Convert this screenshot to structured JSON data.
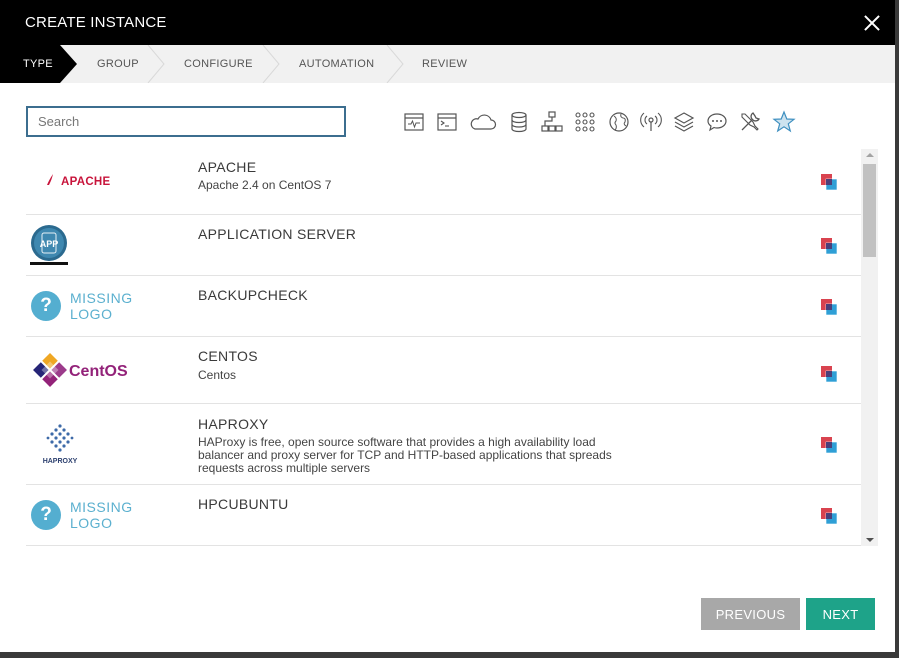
{
  "modal": {
    "title": "CREATE INSTANCE"
  },
  "wizard": {
    "steps": [
      {
        "label": "TYPE",
        "active": true
      },
      {
        "label": "GROUP",
        "active": false
      },
      {
        "label": "CONFIGURE",
        "active": false
      },
      {
        "label": "AUTOMATION",
        "active": false
      },
      {
        "label": "REVIEW",
        "active": false
      }
    ]
  },
  "search": {
    "placeholder": "Search",
    "value": ""
  },
  "filters": [
    "web-icon",
    "terminal-icon",
    "cloud-icon",
    "database-icon",
    "network-icon",
    "grid-icon",
    "globe-icon",
    "wireless-icon",
    "layers-icon",
    "chat-icon",
    "tools-icon",
    "star-icon"
  ],
  "items": [
    {
      "name": "APACHE",
      "description": "Apache 2.4 on CentOS 7",
      "logo": "apache-logo",
      "logo_text": "APACHE"
    },
    {
      "name": "APPLICATION SERVER",
      "description": "",
      "logo": "app-logo",
      "logo_text": "APP"
    },
    {
      "name": "BACKUPCHECK",
      "description": "",
      "logo": "missing-logo",
      "logo_text": "MISSING LOGO"
    },
    {
      "name": "CENTOS",
      "description": "Centos",
      "logo": "centos-logo",
      "logo_text": "CentOS"
    },
    {
      "name": "HAPROXY",
      "description": "HAProxy is free, open source software that provides a high availability load balancer and proxy server for TCP and HTTP-based applications that spreads requests across multiple servers",
      "logo": "haproxy-logo",
      "logo_text": "HAPROXY"
    },
    {
      "name": "HPCUBUNTU",
      "description": "",
      "logo": "missing-logo",
      "logo_text": "MISSING LOGO"
    }
  ],
  "missing_logo": {
    "mark": "?",
    "line1": "MISSING",
    "line2": "LOGO"
  },
  "buttons": {
    "previous": "PREVIOUS",
    "next": "NEXT"
  },
  "colors": {
    "accent_next": "#1ea389",
    "search_border": "#3c6e8f",
    "missing_logo": "#54aed0"
  }
}
